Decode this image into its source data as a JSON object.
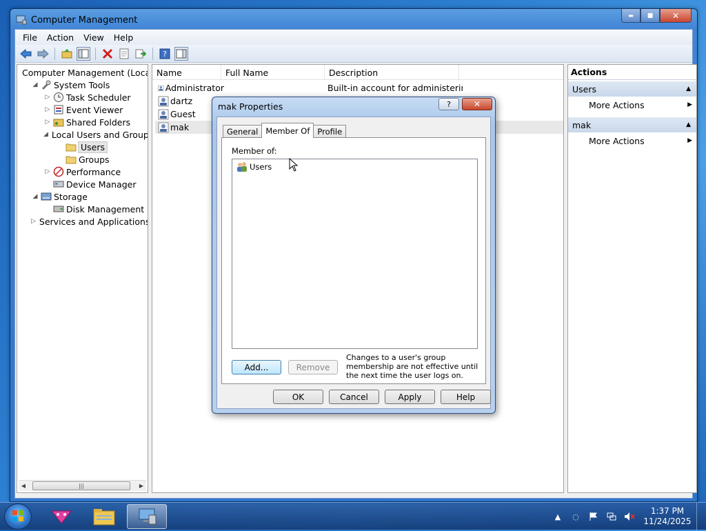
{
  "window": {
    "title": "Computer Management",
    "caption_min": "▬",
    "caption_max": "■",
    "caption_close": "✕"
  },
  "menu": [
    "File",
    "Action",
    "View",
    "Help"
  ],
  "toolbar_icons": [
    "back-icon",
    "forward-icon",
    "up-folder-icon",
    "show-hide-tree-icon",
    "delete-icon",
    "properties-icon",
    "export-icon",
    "help-icon",
    "show-hide-action-pane-icon"
  ],
  "tree": {
    "items": [
      {
        "label": "Computer Management (Local",
        "indent": 0,
        "expander": "",
        "icon": "computer-icon"
      },
      {
        "label": "System Tools",
        "indent": 1,
        "expander": "◢",
        "icon": "tools-icon"
      },
      {
        "label": "Task Scheduler",
        "indent": 2,
        "expander": "▷",
        "icon": "clock-icon"
      },
      {
        "label": "Event Viewer",
        "indent": 2,
        "expander": "▷",
        "icon": "event-viewer-icon"
      },
      {
        "label": "Shared Folders",
        "indent": 2,
        "expander": "▷",
        "icon": "shared-folder-icon"
      },
      {
        "label": "Local Users and Groups",
        "indent": 2,
        "expander": "◢",
        "icon": "users-groups-icon"
      },
      {
        "label": "Users",
        "indent": 3,
        "expander": "",
        "icon": "folder-icon",
        "selected": true
      },
      {
        "label": "Groups",
        "indent": 3,
        "expander": "",
        "icon": "folder-icon"
      },
      {
        "label": "Performance",
        "indent": 2,
        "expander": "▷",
        "icon": "performance-icon"
      },
      {
        "label": "Device Manager",
        "indent": 2,
        "expander": "",
        "icon": "device-manager-icon"
      },
      {
        "label": "Storage",
        "indent": 1,
        "expander": "◢",
        "icon": "storage-icon"
      },
      {
        "label": "Disk Management",
        "indent": 2,
        "expander": "",
        "icon": "disk-icon"
      },
      {
        "label": "Services and Applications",
        "indent": 1,
        "expander": "▷",
        "icon": "services-icon"
      }
    ]
  },
  "list": {
    "columns": [
      "Name",
      "Full Name",
      "Description"
    ],
    "rows": [
      {
        "name": "Administrator",
        "full_name": "",
        "description": "Built-in account for administering..."
      },
      {
        "name": "dartz",
        "full_name": "",
        "description": ""
      },
      {
        "name": "Guest",
        "full_name": "",
        "description": ""
      },
      {
        "name": "mak",
        "full_name": "",
        "description": "",
        "selected": true
      }
    ]
  },
  "actions": {
    "header": "Actions",
    "sections": [
      {
        "title": "Users",
        "items": [
          "More Actions"
        ]
      },
      {
        "title": "mak",
        "items": [
          "More Actions"
        ]
      }
    ]
  },
  "dialog": {
    "title": "mak Properties",
    "help_glyph": "?",
    "close_glyph": "✕",
    "tabs": [
      "General",
      "Member Of",
      "Profile"
    ],
    "active_tab": "Member Of",
    "member_of_label": "Member of:",
    "members": [
      "Users"
    ],
    "add_label": "Add...",
    "remove_label": "Remove",
    "note": "Changes to a user's group membership are not effective until the next time the user logs on.",
    "ok_label": "OK",
    "cancel_label": "Cancel",
    "apply_label": "Apply",
    "help_label": "Help"
  },
  "taskbar": {
    "apps": [
      "paint-app-icon",
      "explorer-icon",
      "computer-management-icon"
    ],
    "clock_time": "1:37 PM",
    "clock_date": "11/24/2025"
  },
  "colors": {
    "accent": "#2f75cc",
    "selection": "#e5e5e5"
  }
}
